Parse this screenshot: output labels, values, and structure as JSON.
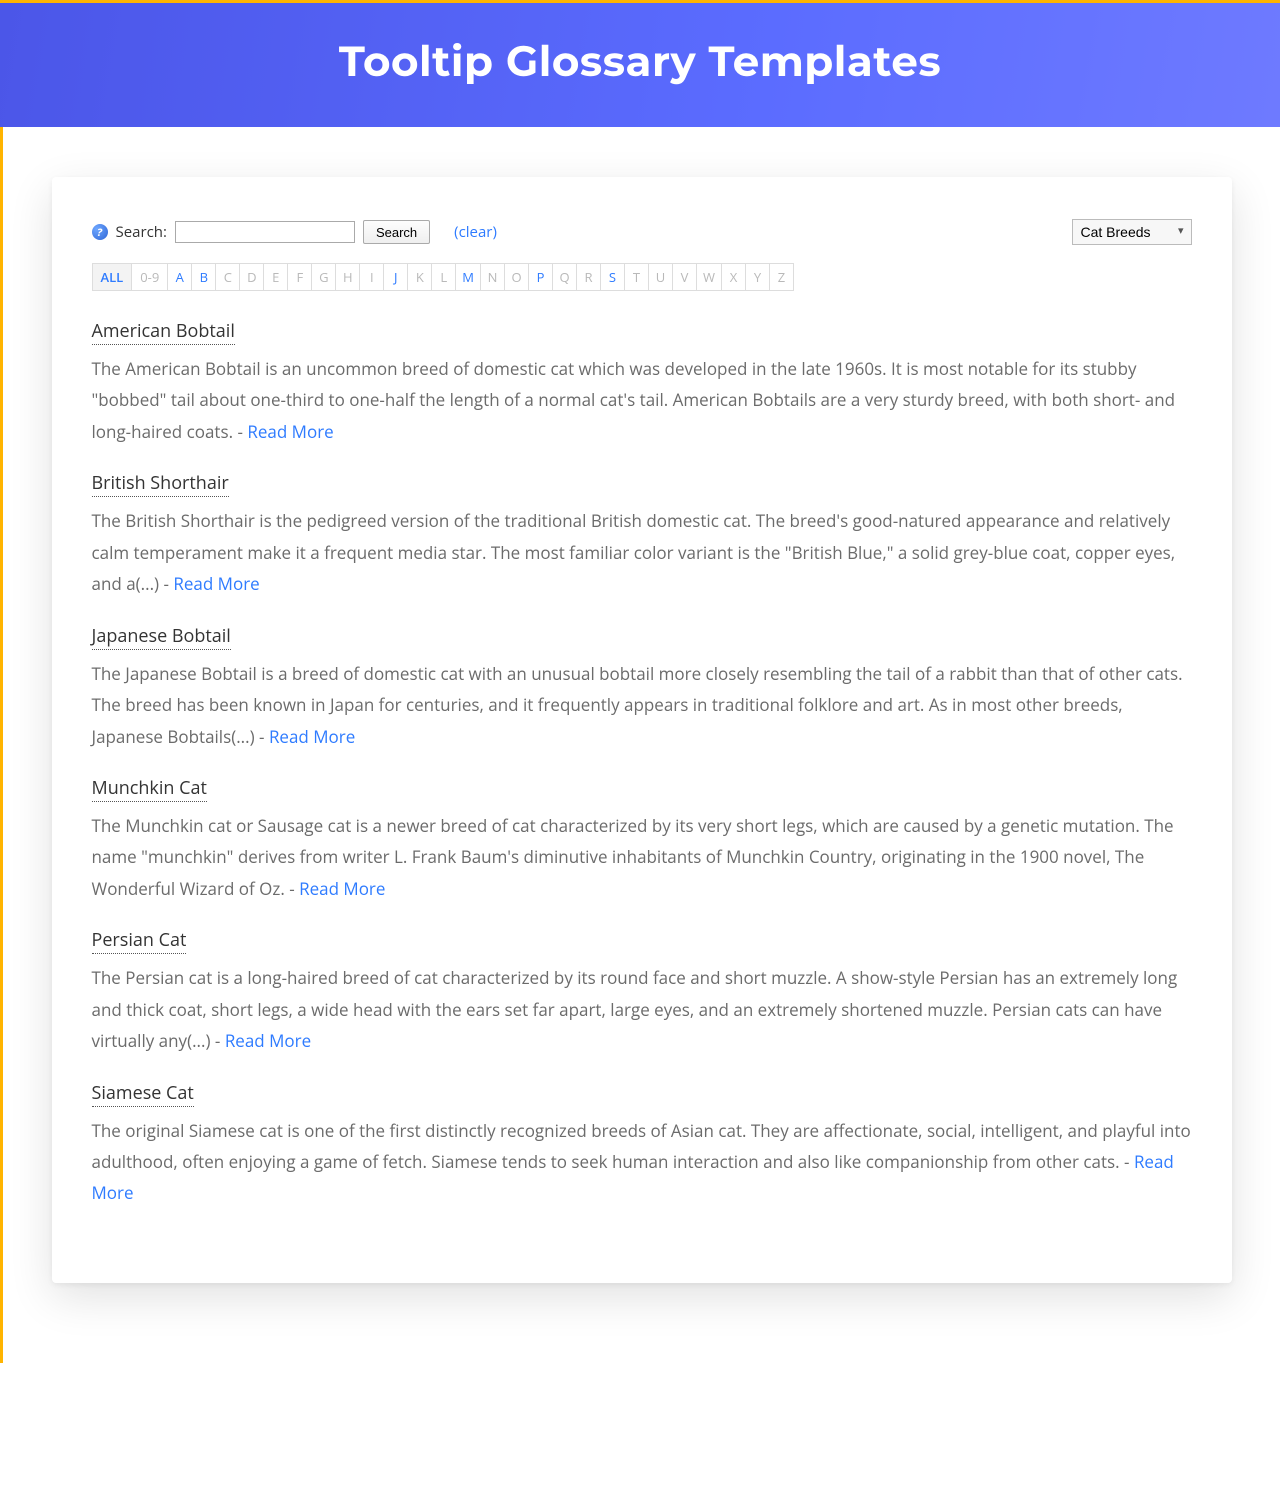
{
  "header": {
    "title": "Tooltip Glossary Templates"
  },
  "search": {
    "label": "Search:",
    "button": "Search",
    "clear": "(clear)",
    "value": ""
  },
  "category_select": {
    "selected": "Cat Breeds"
  },
  "alphabet": [
    {
      "label": "ALL",
      "active": true,
      "selected": true,
      "wide": true
    },
    {
      "label": "0-9",
      "active": false,
      "selected": false,
      "wide": true
    },
    {
      "label": "A",
      "active": true
    },
    {
      "label": "B",
      "active": true
    },
    {
      "label": "C",
      "active": false
    },
    {
      "label": "D",
      "active": false
    },
    {
      "label": "E",
      "active": false
    },
    {
      "label": "F",
      "active": false
    },
    {
      "label": "G",
      "active": false
    },
    {
      "label": "H",
      "active": false
    },
    {
      "label": "I",
      "active": false
    },
    {
      "label": "J",
      "active": true
    },
    {
      "label": "K",
      "active": false
    },
    {
      "label": "L",
      "active": false
    },
    {
      "label": "M",
      "active": true
    },
    {
      "label": "N",
      "active": false
    },
    {
      "label": "O",
      "active": false
    },
    {
      "label": "P",
      "active": true
    },
    {
      "label": "Q",
      "active": false
    },
    {
      "label": "R",
      "active": false
    },
    {
      "label": "S",
      "active": true
    },
    {
      "label": "T",
      "active": false
    },
    {
      "label": "U",
      "active": false
    },
    {
      "label": "V",
      "active": false
    },
    {
      "label": "W",
      "active": false
    },
    {
      "label": "X",
      "active": false
    },
    {
      "label": "Y",
      "active": false
    },
    {
      "label": "Z",
      "active": false
    }
  ],
  "entries": [
    {
      "title": "American Bobtail",
      "desc": "The American Bobtail is an uncommon breed of domestic cat which was developed in the late 1960s. It is most notable for its stubby \"bobbed\" tail about one-third to one-half the length of a normal cat's tail. American Bobtails are a very sturdy breed, with both short- and long-haired coats.",
      "read_more": "Read More"
    },
    {
      "title": "British Shorthair",
      "desc": "The British Shorthair is the pedigreed version of the traditional British domestic cat. The breed's good-natured appearance and relatively calm temperament make it a frequent media star. The most familiar color variant is the \"British Blue,\" a solid grey-blue coat, copper eyes, and a(...)",
      "read_more": "Read More"
    },
    {
      "title": "Japanese Bobtail",
      "desc": "The Japanese Bobtail is a breed of domestic cat with an unusual bobtail more closely resembling the tail of a rabbit than that of other cats. The breed has been known in Japan for centuries, and it frequently appears in traditional folklore and art. As in most other breeds, Japanese Bobtails(...)",
      "read_more": "Read More"
    },
    {
      "title": "Munchkin Cat",
      "desc": "The Munchkin cat or Sausage cat is a newer breed of cat characterized by its very short legs, which are caused by a genetic mutation. The name \"munchkin\" derives from writer L. Frank Baum's diminutive inhabitants of Munchkin Country, originating in the 1900 novel, The Wonderful Wizard of Oz.",
      "read_more": "Read More"
    },
    {
      "title": "Persian Cat",
      "desc": "The Persian cat is a long-haired breed of cat characterized by its round face and short muzzle. A show-style Persian has an extremely long and thick coat, short legs, a wide head with the ears set far apart, large eyes, and an extremely shortened muzzle. Persian cats can have virtually any(...)",
      "read_more": "Read More"
    },
    {
      "title": "Siamese Cat",
      "desc": "The original Siamese cat is one of the first distinctly recognized breeds of Asian cat. They are affectionate, social, intelligent, and playful into adulthood, often enjoying a game of fetch. Siamese tends to seek human interaction and also like companionship from other cats.",
      "read_more": "Read More"
    }
  ],
  "strings": {
    "dash": " - "
  }
}
